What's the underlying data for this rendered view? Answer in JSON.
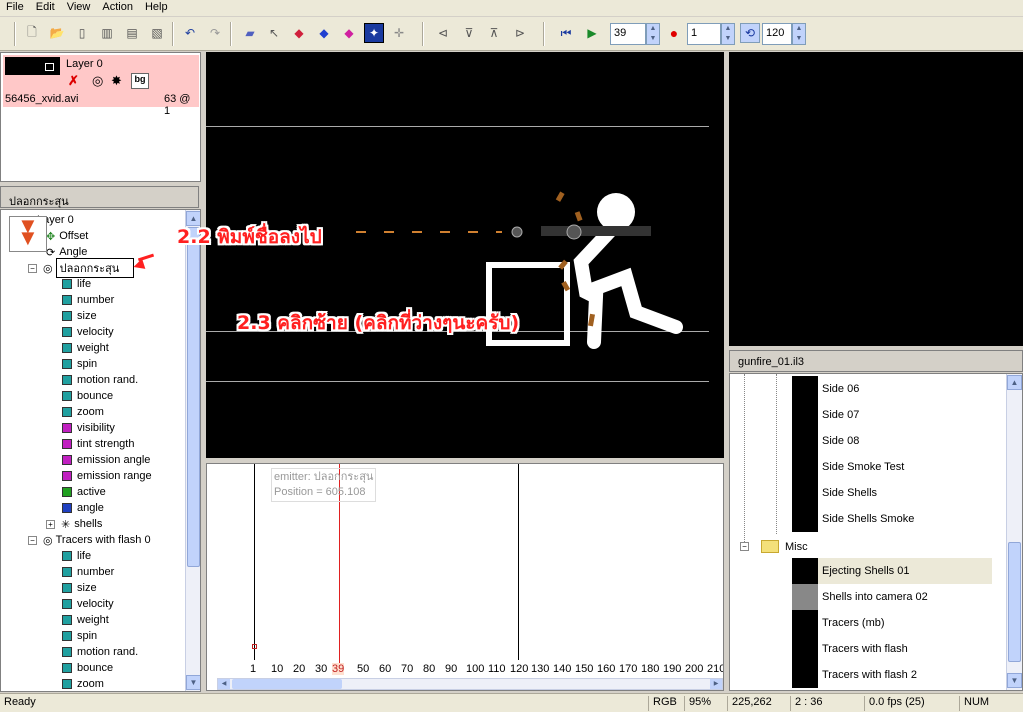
{
  "menu": [
    "File",
    "Edit",
    "View",
    "Action",
    "Help"
  ],
  "toolbar": {
    "frame": "39",
    "record_value": "1",
    "loop_value": "120"
  },
  "layer_panel": {
    "layer_name": "Layer 0",
    "file": "56456_xvid.avi",
    "frame_info": "63 @ 1"
  },
  "emitter_tree": {
    "title": "ปลอกกระสุน",
    "root": "Layer 0",
    "root_items": [
      "Offset",
      "Angle"
    ],
    "emitter1_name": "ปลอกกระสุน",
    "emitter1_props": [
      {
        "label": "life",
        "color": "#20a0a0"
      },
      {
        "label": "number",
        "color": "#20a0a0"
      },
      {
        "label": "size",
        "color": "#20a0a0"
      },
      {
        "label": "velocity",
        "color": "#20a0a0"
      },
      {
        "label": "weight",
        "color": "#20a0a0"
      },
      {
        "label": "spin",
        "color": "#20a0a0"
      },
      {
        "label": "motion rand.",
        "color": "#20a0a0"
      },
      {
        "label": "bounce",
        "color": "#20a0a0"
      },
      {
        "label": "zoom",
        "color": "#20a0a0"
      },
      {
        "label": "visibility",
        "color": "#c020c0"
      },
      {
        "label": "tint strength",
        "color": "#c020c0"
      },
      {
        "label": "emission angle",
        "color": "#c020c0"
      },
      {
        "label": "emission range",
        "color": "#c020c0"
      },
      {
        "label": "active",
        "color": "#20a020"
      },
      {
        "label": "angle",
        "color": "#2040c0"
      }
    ],
    "emitter1_shells": "shells",
    "emitter2_name": "Tracers with flash 0",
    "emitter2_props": [
      "life",
      "number",
      "size",
      "velocity",
      "weight",
      "spin",
      "motion rand.",
      "bounce",
      "zoom"
    ]
  },
  "annotations": {
    "a1": "2.2 พิมพ์ชื่อลงไป",
    "a2": "2.3 คลิกซ้าย (คลิกที่ว่างๆนะครับ)"
  },
  "timeline": {
    "tooltip_line1": "emitter: ปลอกกระสุน",
    "tooltip_line2": "Position = 605.108",
    "current_frame": "39",
    "ticks": [
      "1",
      "10",
      "20",
      "30",
      "39",
      "50",
      "60",
      "70",
      "80",
      "90",
      "100",
      "110",
      "120",
      "130",
      "140",
      "150",
      "160",
      "170",
      "180",
      "190",
      "200",
      "210"
    ]
  },
  "library": {
    "title": "gunfire_01.il3",
    "items": [
      "Side 06",
      "Side 07",
      "Side 08",
      "Side Smoke Test",
      "Side Shells",
      "Side Shells Smoke"
    ],
    "folder": "Misc",
    "misc_items": [
      "Ejecting Shells 01",
      "Shells into camera 02",
      "Tracers (mb)",
      "Tracers with flash",
      "Tracers with flash 2"
    ]
  },
  "status": {
    "ready": "Ready",
    "mode": "RGB",
    "zoom": "95%",
    "coords": "225,262",
    "time": "2 : 36",
    "fps": "0.0 fps (25)",
    "num": "NUM"
  }
}
